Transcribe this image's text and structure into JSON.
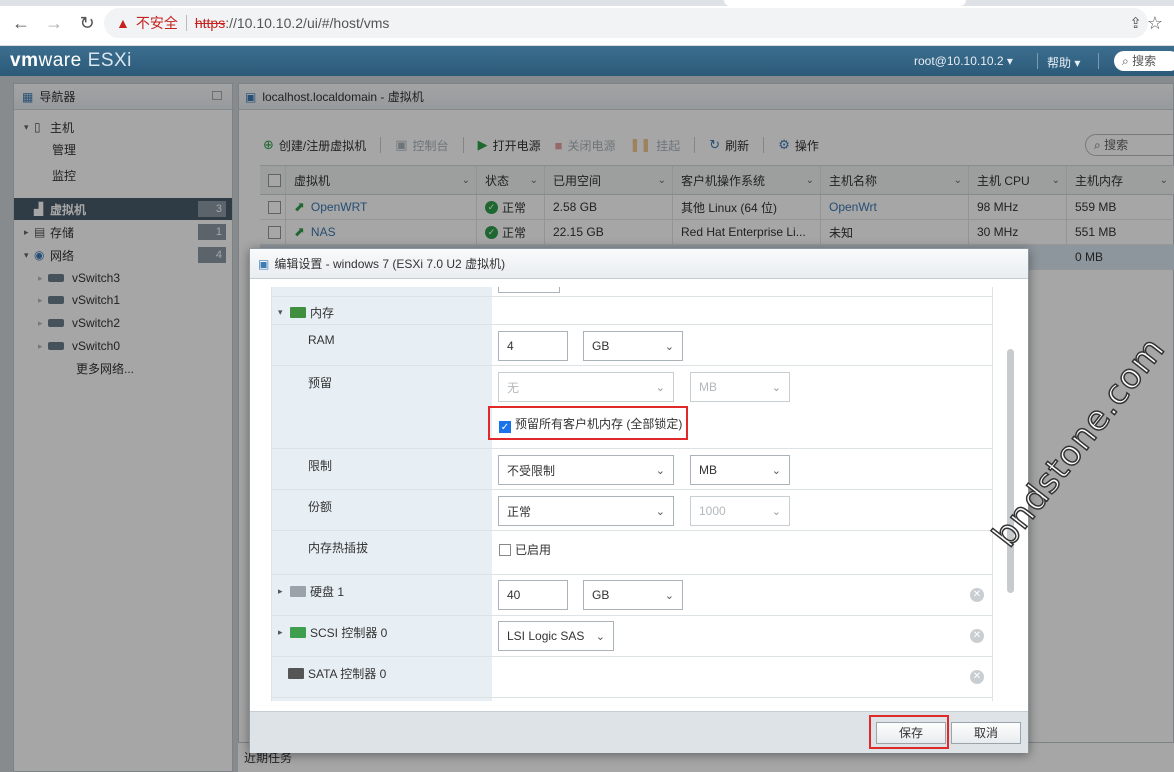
{
  "browser": {
    "insecure_label": "不安全",
    "url_proto": "https",
    "url_rest": "://10.10.10.2/ui/#/host/vms"
  },
  "header": {
    "brand_vm": "vm",
    "brand_ware": "ware",
    "brand_esxi": "ESXi",
    "user": "root@10.10.10.2 ▾",
    "help": "帮助 ▾",
    "search": "搜索"
  },
  "navigator": {
    "title": "导航器",
    "host": "主机",
    "manage": "管理",
    "monitor": "监控",
    "vms": "虚拟机",
    "vms_count": "3",
    "storage": "存储",
    "storage_count": "1",
    "network": "网络",
    "network_count": "4",
    "switches": [
      "vSwitch3",
      "vSwitch1",
      "vSwitch2",
      "vSwitch0"
    ],
    "more": "更多网络..."
  },
  "main": {
    "title": "localhost.localdomain - 虚拟机",
    "toolbar": {
      "create": "创建/注册虚拟机",
      "console": "控制台",
      "power_on": "打开电源",
      "power_off": "关闭电源",
      "suspend": "挂起",
      "refresh": "刷新",
      "actions": "操作"
    },
    "search": "搜索",
    "columns": [
      "虚拟机",
      "状态",
      "已用空间",
      "客户机操作系统",
      "主机名称",
      "主机 CPU",
      "主机内存"
    ],
    "rows": [
      {
        "name": "OpenWRT",
        "status": "正常",
        "used": "2.58 GB",
        "os": "其他 Linux (64 位)",
        "host": "OpenWrt",
        "cpu": "98 MHz",
        "mem": "559 MB"
      },
      {
        "name": "NAS",
        "status": "正常",
        "used": "22.15 GB",
        "os": "Red Hat Enterprise Li...",
        "host": "未知",
        "cpu": "30 MHz",
        "mem": "551 MB"
      }
    ],
    "partial_mem": "0 MB",
    "recent_tasks": "近期任务"
  },
  "dialog": {
    "title": "编辑设置 - windows 7 (ESXi 7.0 U2 虚拟机)",
    "memory": "内存",
    "ram_label": "RAM",
    "ram_value": "4",
    "ram_unit": "GB",
    "reservation_label": "预留",
    "reservation_value": "无",
    "reservation_unit": "MB",
    "reserve_all": "预留所有客户机内存 (全部锁定)",
    "limit_label": "限制",
    "limit_value": "不受限制",
    "limit_unit": "MB",
    "shares_label": "份额",
    "shares_value": "正常",
    "shares_num": "1000",
    "hotplug_label": "内存热插拔",
    "hotplug_enabled": "已启用",
    "disk_label": "硬盘 1",
    "disk_value": "40",
    "disk_unit": "GB",
    "scsi_label": "SCSI 控制器 0",
    "scsi_value": "LSI Logic SAS",
    "sata_label": "SATA 控制器 0",
    "save": "保存",
    "cancel": "取消"
  },
  "watermark": "bndstone.com"
}
